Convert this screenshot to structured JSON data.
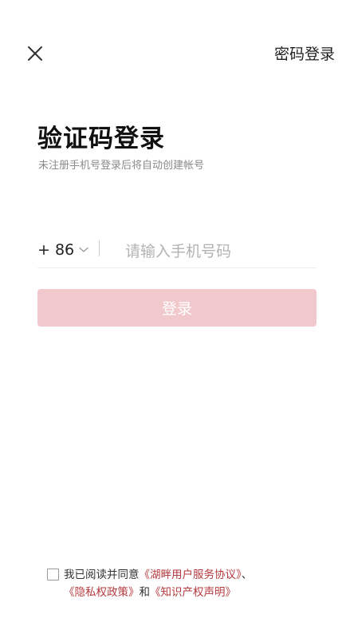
{
  "header": {
    "close_icon": "close-icon",
    "password_login_label": "密码登录"
  },
  "form": {
    "title": "验证码登录",
    "subtitle": "未注册手机号登录后将自动创建帐号",
    "country_code": "+ 86",
    "chevron_icon": "chevron-down-icon",
    "phone_placeholder": "请输入手机号码",
    "phone_value": "",
    "login_button_label": "登录"
  },
  "agreement": {
    "checked": false,
    "prefix": "我已阅读并同意",
    "link_service": "《湖畔用户服务协议》",
    "separator": "、",
    "link_privacy": "《隐私权政策》",
    "conjunction": "和",
    "link_ip": "《知识产权声明》"
  },
  "colors": {
    "accent": "#b53a3f",
    "button_disabled_bg": "#f1c9cc",
    "text_primary": "#222222",
    "text_secondary": "#8a8a8a",
    "placeholder": "#b3b3b3"
  }
}
